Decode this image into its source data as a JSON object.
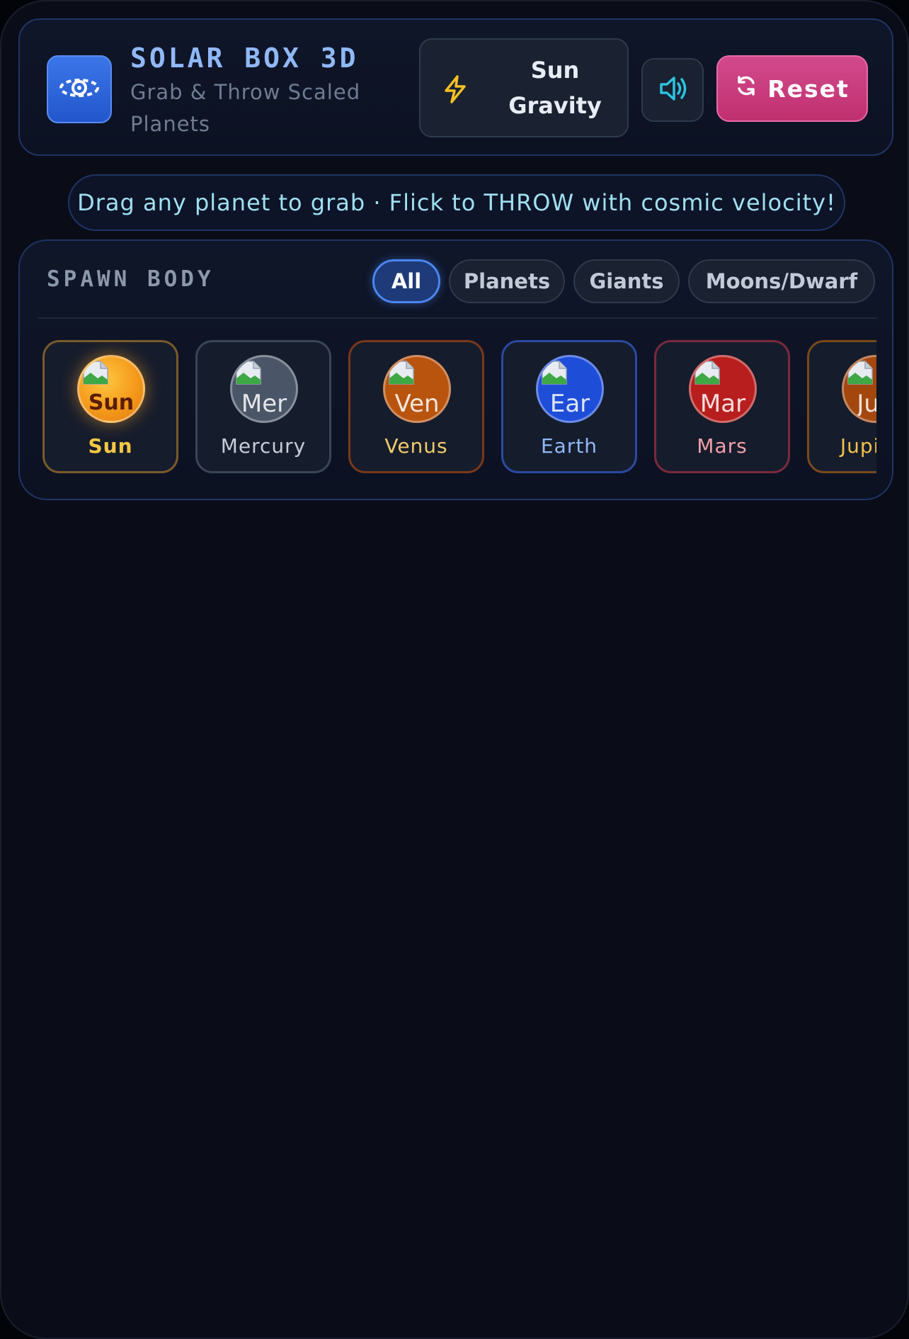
{
  "header": {
    "title": "SOLAR BOX 3D",
    "subtitle": "Grab & Throw Scaled Planets",
    "logo_icon": "eye-orbit-icon",
    "gravity_label": "Sun Gravity",
    "gravity_icon": "lightning-bolt-icon",
    "sound_icon": "speaker-icon",
    "reset_label": "Reset",
    "reset_icon": "refresh-icon"
  },
  "hint": "Drag any planet to grab · Flick to THROW with cosmic velocity!",
  "spawn": {
    "title": "SPAWN BODY",
    "filters": [
      "All",
      "Planets",
      "Giants",
      "Moons/Dwarf"
    ],
    "active_filter": "All",
    "bodies": [
      {
        "name": "Sun",
        "orb_text": "Sun",
        "color": "#f5a022",
        "border": "#7a5a2a",
        "text_color": "#f5c842"
      },
      {
        "name": "Mercury",
        "orb_text": "Mer",
        "color": "#4a5568",
        "border": "#3a4558",
        "text_color": "#c8ccd6"
      },
      {
        "name": "Venus",
        "orb_text": "Ven",
        "color": "#b8540e",
        "border": "#7a3818",
        "text_color": "#f2cc6a"
      },
      {
        "name": "Earth",
        "orb_text": "Ear",
        "color": "#1e4ed8",
        "border": "#2a4aa0",
        "text_color": "#90b8f8"
      },
      {
        "name": "Mars",
        "orb_text": "Mar",
        "color": "#b81e1e",
        "border": "#7a2a3a",
        "text_color": "#f0a0a8"
      },
      {
        "name": "Jupiter",
        "orb_text": "Jup",
        "color": "#a4470e",
        "border": "#7a4a1a",
        "text_color": "#f2c24a"
      }
    ]
  }
}
